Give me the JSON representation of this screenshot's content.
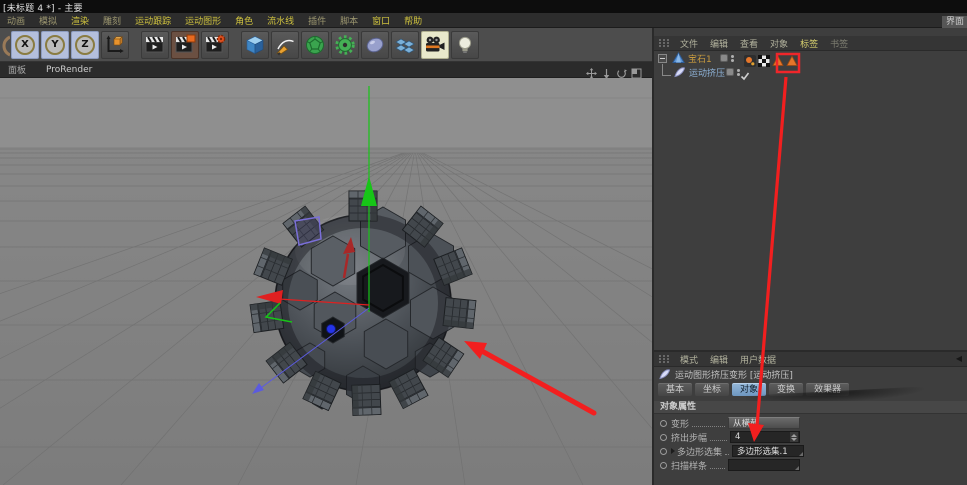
{
  "window": {
    "title": "[未标题 4 *] - 主要",
    "layout_button": "界面"
  },
  "menu_bar": {
    "items": [
      {
        "label": "动画",
        "bright": false
      },
      {
        "label": "模拟",
        "bright": false
      },
      {
        "label": "渲染",
        "bright": true
      },
      {
        "label": "雕刻",
        "bright": false
      },
      {
        "label": "运动跟踪",
        "bright": true
      },
      {
        "label": "运动图形",
        "bright": true
      },
      {
        "label": "角色",
        "bright": true
      },
      {
        "label": "流水线",
        "bright": true
      },
      {
        "label": "插件",
        "bright": false
      },
      {
        "label": "脚本",
        "bright": false
      },
      {
        "label": "窗口",
        "bright": true
      },
      {
        "label": "帮助",
        "bright": true
      }
    ]
  },
  "toolbar": {
    "buttons": [
      {
        "name": "undo-partial-icon",
        "type": "partial"
      },
      {
        "name": "lock-x-axis-button",
        "type": "letter",
        "label": "X"
      },
      {
        "name": "lock-y-axis-button",
        "type": "letter",
        "label": "Y"
      },
      {
        "name": "lock-z-axis-button",
        "type": "letter",
        "label": "Z"
      },
      {
        "name": "coordinate-system-button",
        "type": "icon",
        "icon": "coord"
      },
      {
        "name": "render-view-button",
        "type": "icon",
        "icon": "clapper",
        "gap": true
      },
      {
        "name": "render-picture-viewer-button",
        "type": "icon",
        "icon": "clapperOrange",
        "warm": true
      },
      {
        "name": "render-settings-button",
        "type": "icon",
        "icon": "clapperGear"
      },
      {
        "name": "add-cube-button",
        "type": "icon",
        "icon": "cube",
        "gap": true
      },
      {
        "name": "freehand-spline-button",
        "type": "icon",
        "icon": "pen"
      },
      {
        "name": "mograph-object-button",
        "type": "icon",
        "icon": "greenball"
      },
      {
        "name": "deformer-button",
        "type": "icon",
        "icon": "gear"
      },
      {
        "name": "metaball-button",
        "type": "icon",
        "icon": "metaball"
      },
      {
        "name": "array-button",
        "type": "icon",
        "icon": "array"
      },
      {
        "name": "scene-camera-button",
        "type": "icon",
        "icon": "camera",
        "active": true
      },
      {
        "name": "scene-light-button",
        "type": "icon",
        "icon": "bulb"
      }
    ]
  },
  "viewport": {
    "menu": [
      "面板",
      "ProRender"
    ],
    "nav_icons": [
      "pan-view-icon",
      "dolly-view-icon",
      "rotate-view-icon",
      "toggle-panels-icon"
    ]
  },
  "object_manager": {
    "menu_items": [
      {
        "label": "文件"
      },
      {
        "label": "编辑"
      },
      {
        "label": "查看"
      },
      {
        "label": "对象"
      },
      {
        "label": "标签",
        "bright": true
      },
      {
        "label": "书签",
        "dim": true
      }
    ],
    "objects": [
      {
        "name": "宝石1",
        "selected": true,
        "tags": [
          "display-tag",
          "texture-tag",
          "phong-tag",
          "phong-tag"
        ]
      },
      {
        "name": "运动挤压",
        "child": true,
        "checked": true
      }
    ]
  },
  "attribute_manager": {
    "menu_items": [
      {
        "label": "模式"
      },
      {
        "label": "编辑"
      },
      {
        "label": "用户数据"
      }
    ],
    "title": "运动图形挤压变形 [运动挤压]",
    "tabs": [
      {
        "label": "基本"
      },
      {
        "label": "坐标"
      },
      {
        "label": "对象",
        "selected": true
      },
      {
        "label": "变换"
      },
      {
        "label": "效果器"
      }
    ],
    "section_header": "对象属性",
    "properties": [
      {
        "label": "变形",
        "control": "dropdown",
        "value": "从横截"
      },
      {
        "label": "挤出步幅",
        "control": "number",
        "value": "4"
      },
      {
        "label": "多边形选集",
        "control": "text",
        "value": "多边形选集.1",
        "caret": true
      },
      {
        "label": "扫描样条",
        "control": "text",
        "value": ""
      }
    ]
  },
  "colors": {
    "selected_tab": "#7ba2ca",
    "selected_object_text": "#c79a3f",
    "child_object_text": "#8fb3d8",
    "annotation_red": "#f21f1f",
    "axis_x": "#e02020",
    "axis_y": "#19c819",
    "axis_z": "#5b5bdf",
    "tag_orange": "#e6762a"
  }
}
